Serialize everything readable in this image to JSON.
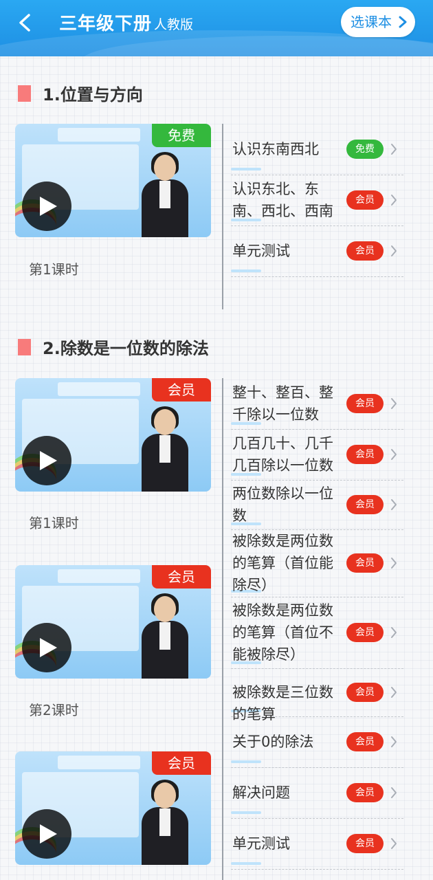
{
  "header": {
    "title": "三年级下册",
    "subtitle": "人教版",
    "select_button": "选课本"
  },
  "colors": {
    "header_blue": "#1e8fe3",
    "free_green": "#34b83d",
    "vip_red": "#e8321f",
    "section_marker": "#f87b7b"
  },
  "sections": [
    {
      "title": "1.位置与方向",
      "videos": [
        {
          "badge": "免费",
          "badge_type": "free",
          "lesson": "第1课时",
          "thumb_icon": "play-icon"
        }
      ],
      "items": [
        {
          "title": "认识东南西北",
          "tag": "免费",
          "tag_type": "free"
        },
        {
          "title": "认识东北、东南、西北、西南",
          "tag": "会员",
          "tag_type": "vip"
        },
        {
          "title": "单元测试",
          "tag": "会员",
          "tag_type": "vip"
        }
      ]
    },
    {
      "title": "2.除数是一位数的除法",
      "videos": [
        {
          "badge": "会员",
          "badge_type": "vip",
          "lesson": "第1课时",
          "thumb_icon": "play-icon"
        },
        {
          "badge": "会员",
          "badge_type": "vip",
          "lesson": "第2课时",
          "thumb_icon": "play-icon"
        },
        {
          "badge": "会员",
          "badge_type": "vip",
          "lesson": "",
          "thumb_icon": "play-icon"
        }
      ],
      "items": [
        {
          "title": "整十、整百、整千除以一位数",
          "tag": "会员",
          "tag_type": "vip"
        },
        {
          "title": "几百几十、几千几百除以一位数",
          "tag": "会员",
          "tag_type": "vip"
        },
        {
          "title": "两位数除以一位数",
          "tag": "会员",
          "tag_type": "vip"
        },
        {
          "title": "被除数是两位数的笔算（首位能除尽）",
          "tag": "会员",
          "tag_type": "vip"
        },
        {
          "title": "被除数是两位数的笔算（首位不能被除尽）",
          "tag": "会员",
          "tag_type": "vip"
        },
        {
          "title": "被除数是三位数的笔算",
          "tag": "会员",
          "tag_type": "vip"
        },
        {
          "title": "关于0的除法",
          "tag": "会员",
          "tag_type": "vip"
        },
        {
          "title": "解决问题",
          "tag": "会员",
          "tag_type": "vip"
        },
        {
          "title": "单元测试",
          "tag": "会员",
          "tag_type": "vip"
        }
      ]
    }
  ]
}
